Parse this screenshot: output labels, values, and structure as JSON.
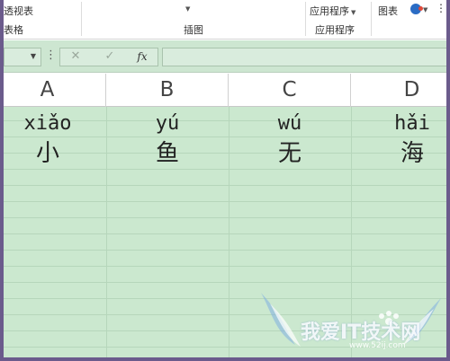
{
  "ribbon": {
    "pivot_table": "透视表",
    "table_fragment": "表格",
    "illustrations": "插图",
    "apps_button": "应用程序",
    "apps_group": "应用程序",
    "chart": "图表"
  },
  "formula_bar": {
    "cancel_glyph": "✕",
    "enter_glyph": "✓",
    "fx_label": "fx",
    "name_value": "",
    "formula_value": ""
  },
  "columns": [
    "A",
    "B",
    "C",
    "D"
  ],
  "rows": [
    {
      "A": "xiǎo",
      "B": "yú",
      "C": "wú",
      "D": "hǎi"
    },
    {
      "A": "小",
      "B": "鱼",
      "C": "无",
      "D": "海"
    }
  ],
  "watermark": {
    "text": "我爱IT技术网",
    "url": "www.52ij.com"
  },
  "colors": {
    "grid_fill": "#cbe8cf",
    "gridline": "#b6d6bb",
    "frame": "#6b5b8c"
  }
}
